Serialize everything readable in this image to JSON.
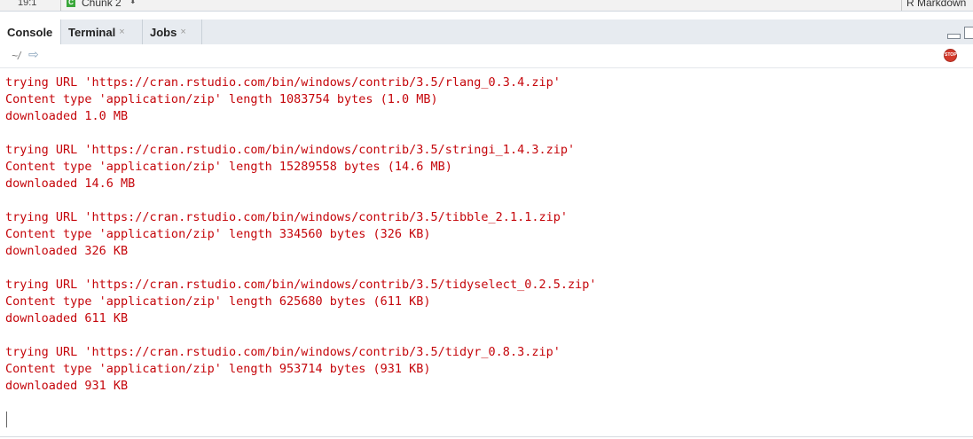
{
  "editor_status": {
    "cursor_position": "19:1",
    "chunk_icon": "C",
    "chunk_label": "Chunk 2",
    "chunk_arrows": "⬍",
    "file_type": "R Markdown"
  },
  "tabs": [
    {
      "label": "Console",
      "closable": false,
      "active": true
    },
    {
      "label": "Terminal",
      "closable": true,
      "active": false
    },
    {
      "label": "Jobs",
      "closable": true,
      "active": false
    }
  ],
  "tab_close_glyph": "×",
  "toolbar": {
    "working_dir": "~/",
    "go_to_dir_glyph": "⇨",
    "stop_label": "STOP"
  },
  "console_output": [
    [
      "trying URL 'https://cran.rstudio.com/bin/windows/contrib/3.5/rlang_0.3.4.zip'",
      "Content type 'application/zip' length 1083754 bytes (1.0 MB)",
      "downloaded 1.0 MB"
    ],
    [
      "trying URL 'https://cran.rstudio.com/bin/windows/contrib/3.5/stringi_1.4.3.zip'",
      "Content type 'application/zip' length 15289558 bytes (14.6 MB)",
      "downloaded 14.6 MB"
    ],
    [
      "trying URL 'https://cran.rstudio.com/bin/windows/contrib/3.5/tibble_2.1.1.zip'",
      "Content type 'application/zip' length 334560 bytes (326 KB)",
      "downloaded 326 KB"
    ],
    [
      "trying URL 'https://cran.rstudio.com/bin/windows/contrib/3.5/tidyselect_0.2.5.zip'",
      "Content type 'application/zip' length 625680 bytes (611 KB)",
      "downloaded 611 KB"
    ],
    [
      "trying URL 'https://cran.rstudio.com/bin/windows/contrib/3.5/tidyr_0.8.3.zip'",
      "Content type 'application/zip' length 953714 bytes (931 KB)",
      "downloaded 931 KB"
    ]
  ],
  "colors": {
    "output_text": "#c5060b",
    "stop_icon": "#d33a2c",
    "chunk_icon": "#3aa73a"
  }
}
